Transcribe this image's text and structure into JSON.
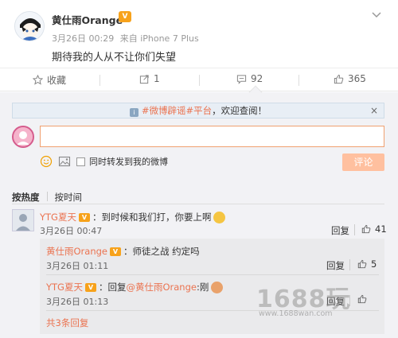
{
  "post": {
    "author": "黄仕雨Orange",
    "vip_badge": "V",
    "date": "3月26日 00:29",
    "source": "来自 iPhone 7 Plus",
    "text": "期待我的人从不让你们失望"
  },
  "actions": {
    "favorite": "收藏",
    "forward": "1",
    "comments": "92",
    "likes": "365"
  },
  "notice": {
    "topic": "#微博辟谣#平台",
    "text": "，欢迎查阅！",
    "close": "×"
  },
  "composer": {
    "input_value": "",
    "forward_label": "同时转发到我的微博",
    "submit_label": "评论"
  },
  "sort": {
    "hot": "按热度",
    "time": "按时间"
  },
  "comments": [
    {
      "nick": "YTG夏天",
      "text": "：到时候和我们打，你要上啊",
      "time": "3月26日 00:47",
      "reply": "回复",
      "likes": "41"
    }
  ],
  "sub_comments": [
    {
      "nick": "黄仕雨Orange",
      "text": "：师徒之战 约定吗",
      "time": "3月26日 01:11",
      "reply": "回复",
      "likes": "5"
    },
    {
      "nick": "YTG夏天",
      "text_prefix": "：回复",
      "mention": "@黄仕雨Orange",
      "text_suffix": ":刚",
      "time": "3月26日 01:13",
      "reply": "回复",
      "likes": ""
    }
  ],
  "more_replies": "共3条回复",
  "watermark": {
    "brand": "1688玩",
    "url": "www.1688wan.com"
  },
  "colors": {
    "accent": "#eb7350",
    "submit": "#ffc09f",
    "link": "#eb7350",
    "vip": "#f7a21b"
  }
}
